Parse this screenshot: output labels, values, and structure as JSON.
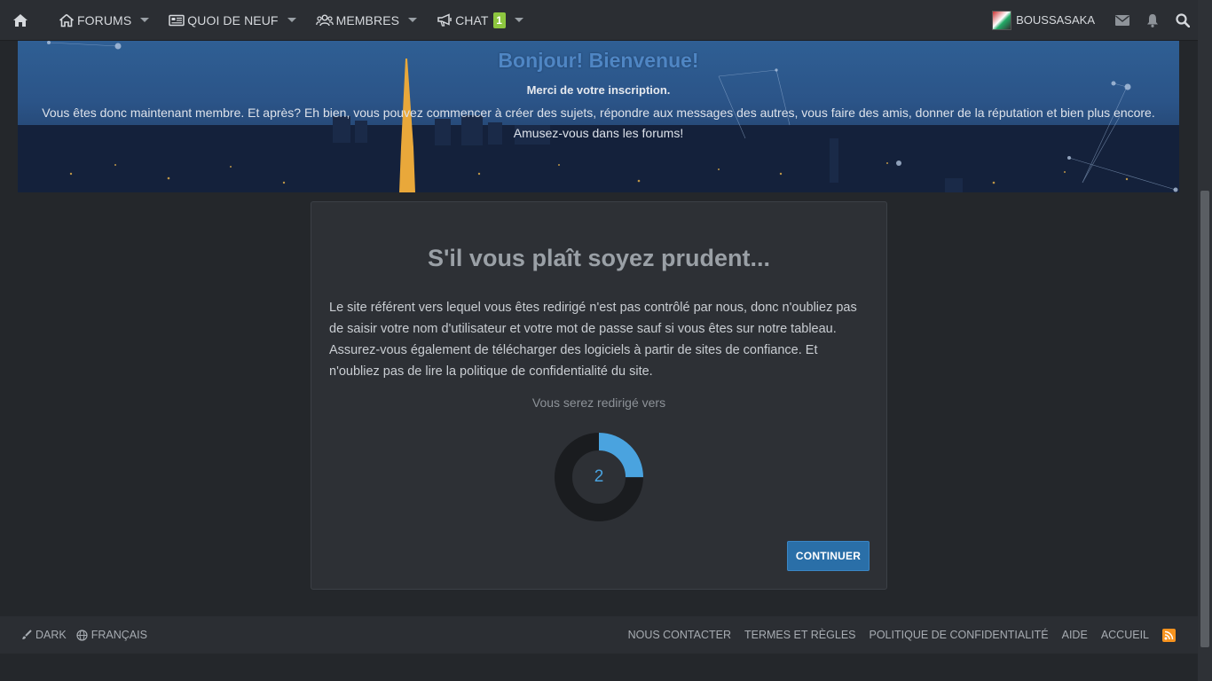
{
  "nav": {
    "forums_label": "FORUMS",
    "whats_new_label": "QUOI DE NEUF",
    "members_label": "MEMBRES",
    "chat_label": "CHAT",
    "chat_badge": "1",
    "username": "BOUSSASAKA",
    "icons": [
      "home-icon",
      "house-icon",
      "newspaper-icon",
      "users-icon",
      "megaphone-icon",
      "envelope-icon",
      "bell-icon",
      "search-icon"
    ]
  },
  "banner": {
    "welcome": "Bonjour! Bienvenue!",
    "thanks": "Merci de votre inscription.",
    "line1": "Vous êtes donc maintenant membre. Et après? Eh bien, vous pouvez commencer à créer des sujets, répondre aux messages des autres, vous faire des amis, donner de la réputation et bien plus encore.",
    "line2": "Amusez-vous dans les forums!"
  },
  "card": {
    "title": "S'il vous plaît soyez prudent...",
    "body": "Le site référent vers lequel vous êtes redirigé n'est pas contrôlé par nous, donc n'oubliez pas de saisir votre nom d'utilisateur et votre mot de passe sauf si vous êtes sur notre tableau. Assurez-vous également de télécharger des logiciels à partir de sites de confiance. Et n'oubliez pas de lire la politique de confidentialité du site.",
    "redirect_text": "Vous serez redirigé vers",
    "countdown": "2",
    "countdown_progress": 0.25,
    "continue_label": "CONTINUER"
  },
  "footer": {
    "style_label": "DARK",
    "language_label": "FRANÇAIS",
    "links": [
      "NOUS CONTACTER",
      "TERMES ET RÈGLES",
      "POLITIQUE DE CONFIDENTIALITÉ",
      "AIDE",
      "ACCUEIL"
    ]
  },
  "colors": {
    "accent": "#4aa3df",
    "button": "#2a6fa8",
    "badge": "#8dc63f",
    "rss": "#f7931e"
  }
}
